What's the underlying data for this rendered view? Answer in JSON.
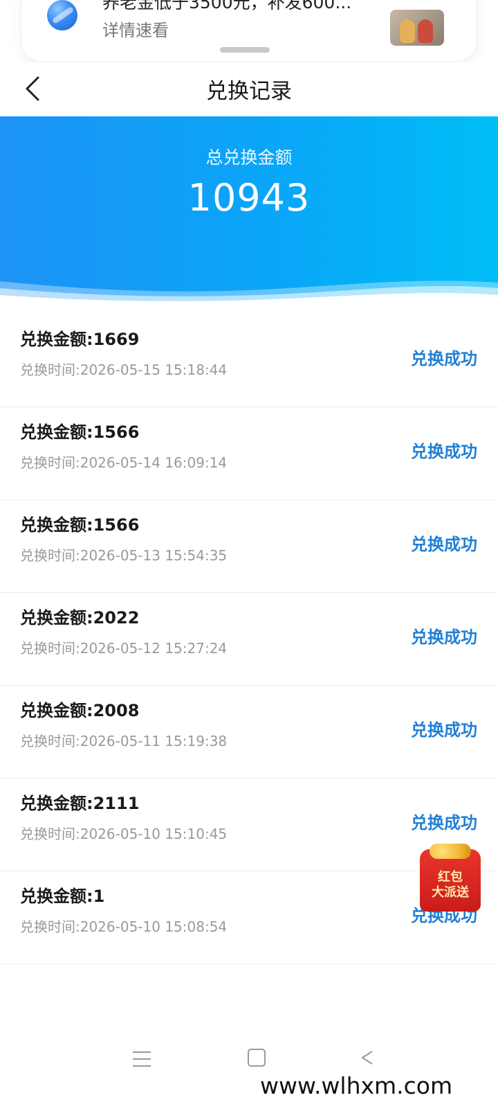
{
  "notification": {
    "title": "养老金低于3500元，补发600...",
    "subtitle": "详情速看",
    "app_icon": "blue-sphere-app-icon",
    "thumbnail": "figurines-thumbnail"
  },
  "header": {
    "title": "兑换记录",
    "back_icon": "chevron-left-icon"
  },
  "banner": {
    "label": "总兑换金额",
    "total": "10943"
  },
  "records": [
    {
      "amount": "兑换金额:1669",
      "time": "兑换时间:2026-05-15 15:18:44",
      "status": "兑换成功"
    },
    {
      "amount": "兑换金额:1566",
      "time": "兑换时间:2026-05-14 16:09:14",
      "status": "兑换成功"
    },
    {
      "amount": "兑换金额:1566",
      "time": "兑换时间:2026-05-13 15:54:35",
      "status": "兑换成功"
    },
    {
      "amount": "兑换金额:2022",
      "time": "兑换时间:2026-05-12 15:27:24",
      "status": "兑换成功"
    },
    {
      "amount": "兑换金额:2008",
      "time": "兑换时间:2026-05-11 15:19:38",
      "status": "兑换成功"
    },
    {
      "amount": "兑换金额:2111",
      "time": "兑换时间:2026-05-10 15:10:45",
      "status": "兑换成功"
    },
    {
      "amount": "兑换金额:1",
      "time": "兑换时间:2026-05-10 15:08:54",
      "status": "兑换成功"
    }
  ],
  "red_packet": {
    "line1": "红包",
    "line2": "大派送"
  },
  "watermark": "www.wlhxm.com",
  "colors": {
    "banner_start": "#1c93f5",
    "banner_end": "#00bdf6",
    "status_blue": "#1f7fd6",
    "red_packet": "#e9352c"
  }
}
